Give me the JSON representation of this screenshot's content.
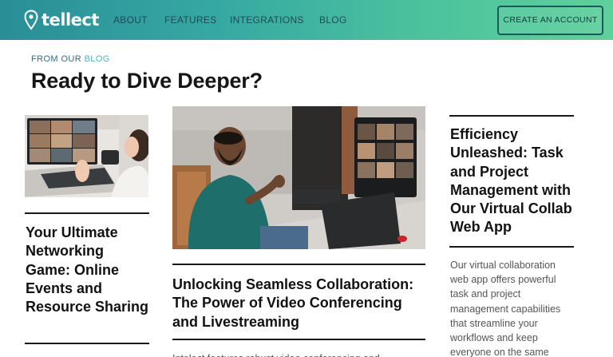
{
  "brand": {
    "name": "tellect"
  },
  "nav": {
    "about": "ABOUT",
    "features": "FEATURES",
    "integrations": "INTEGRATIONS",
    "blog": "BLOG",
    "cta": "CREATE AN ACCOUNT"
  },
  "section": {
    "eyebrow_prefix": "FROM OUR",
    "eyebrow_highlight": "BLOG",
    "title": "Ready to Dive Deeper?"
  },
  "posts": [
    {
      "title": "Your Ultimate Networking Game: Online Events and Resource Sharing",
      "image_icon": "video-call-photo"
    },
    {
      "title": "Unlocking Seamless Collaboration: The Power of Video Conferencing and Livestreaming",
      "excerpt": "Intelect features robust video conferencing and livestreaming capabilities.",
      "image_icon": "man-on-video-call-photo"
    },
    {
      "title": "Efficiency Unleashed: Task and Project Management with Our Virtual Collab Web App",
      "excerpt": "Our virtual collaboration web app offers powerful task and project management capabilities that streamline your workflows and keep everyone on the same"
    }
  ],
  "colors": {
    "header_gradient_start": "#2a8e97",
    "header_gradient_end": "#5fd09c",
    "nav_text": "#1f4b55",
    "eyebrow": "#2f6f7a",
    "eyebrow_highlight": "#4fb3bd"
  }
}
